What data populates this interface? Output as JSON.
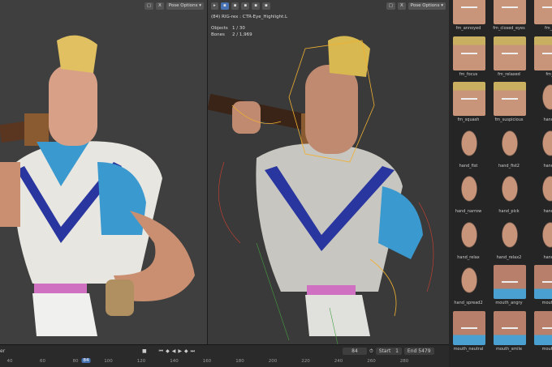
{
  "left_viewport": {
    "pose_options": "Pose Options"
  },
  "right_viewport": {
    "pose_options": "Pose Options",
    "active": "(84) RIG-rex : CTR-Eye_Highlight.L",
    "objects_label": "Objects",
    "objects_value": "1 / 30",
    "bones_label": "Bones",
    "bones_value": "2 / 1,969"
  },
  "assets": [
    {
      "label": "fm_annoyed"
    },
    {
      "label": "fm_closed_eyes"
    },
    {
      "label": "fm_c"
    },
    {
      "label": "fm_focus"
    },
    {
      "label": "fm_relaxed"
    },
    {
      "label": "fm_"
    },
    {
      "label": "fm_squash"
    },
    {
      "label": "fm_suspicious"
    },
    {
      "label": "hand_"
    },
    {
      "label": "hand_fist"
    },
    {
      "label": "hand_fist2"
    },
    {
      "label": "hand_"
    },
    {
      "label": "hand_narrow"
    },
    {
      "label": "hand_pick"
    },
    {
      "label": "hand_"
    },
    {
      "label": "hand_relax"
    },
    {
      "label": "hand_relax2"
    },
    {
      "label": "hand_"
    },
    {
      "label": "hand_spread2"
    },
    {
      "label": "mouth_angry"
    },
    {
      "label": "mouth_"
    },
    {
      "label": "mouth_neutral"
    },
    {
      "label": "mouth_smile"
    },
    {
      "label": "mouth_"
    }
  ],
  "timeline": {
    "left_label": "er",
    "current_frame": "84",
    "start_label": "Start",
    "start": "1",
    "end_label": "End",
    "end": "5479",
    "ticks": [
      "40",
      "60",
      "80",
      "100",
      "120",
      "140",
      "160",
      "180",
      "200",
      "220",
      "240",
      "260",
      "280"
    ]
  },
  "colors": {
    "accent": "#4772b3"
  }
}
